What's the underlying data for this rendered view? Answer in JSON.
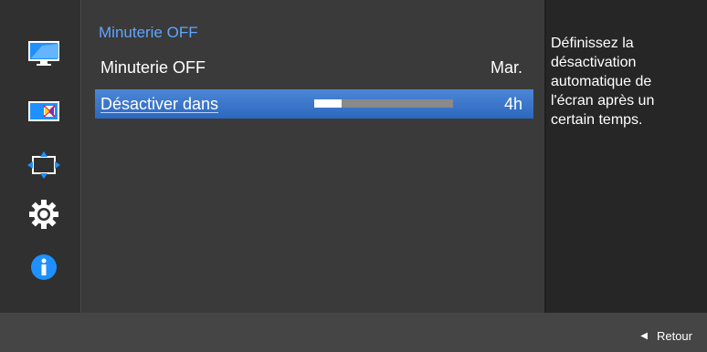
{
  "sidebar": {
    "icons": [
      "monitor-icon",
      "color-adjust-icon",
      "position-icon",
      "settings-gear-icon",
      "info-icon"
    ]
  },
  "menu": {
    "title": "Minuterie OFF",
    "rows": [
      {
        "label": "Minuterie OFF",
        "value": "Mar."
      },
      {
        "label": "Désactiver dans",
        "value": "4h",
        "slider_fraction": 0.2
      }
    ]
  },
  "help": {
    "text": "Définissez la désactivation automatique de l'écran après un certain temps."
  },
  "footer": {
    "back_label": "Retour",
    "back_icon": "triangle-left-icon"
  },
  "colors": {
    "accent": "#5ea6ff",
    "selected_row": "#2c68c0"
  }
}
